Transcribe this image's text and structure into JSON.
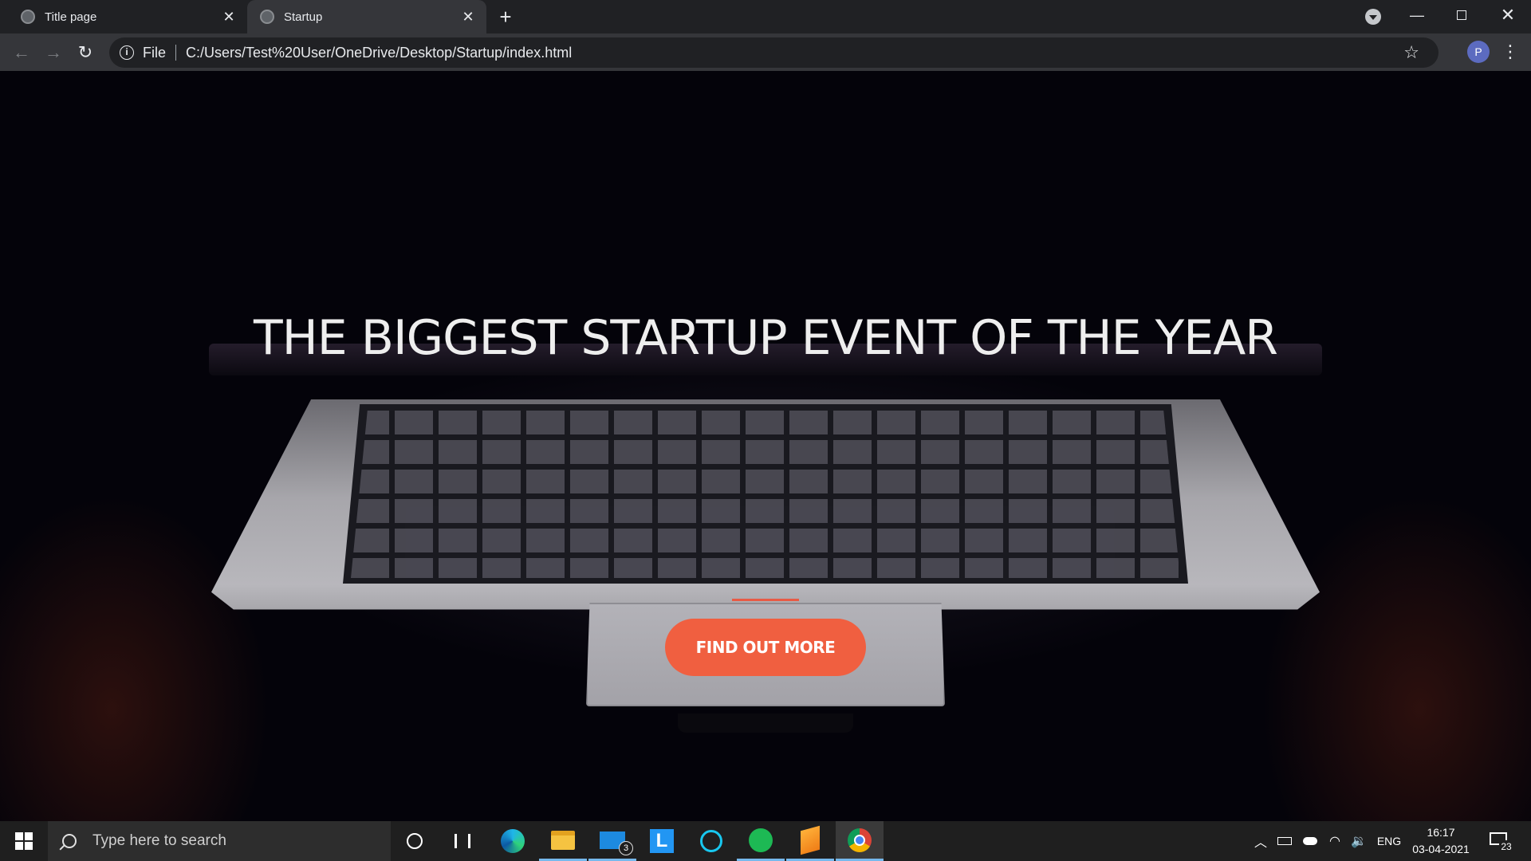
{
  "browser": {
    "tabs": [
      {
        "title": "Title page",
        "active": false
      },
      {
        "title": "Startup",
        "active": true
      }
    ],
    "new_tab_symbol": "+",
    "address_bar": {
      "scheme_label": "File",
      "url": "C:/Users/Test%20User/OneDrive/Desktop/Startup/index.html"
    },
    "profile_initial": "P",
    "icons": {
      "back": "arrow-left-icon",
      "forward": "arrow-right-icon",
      "reload": "reload-icon",
      "info": "info-icon",
      "bookmark": "star-icon",
      "menu": "kebab-menu-icon"
    }
  },
  "page": {
    "hero_title": "THE BIGGEST STARTUP EVENT OF THE YEAR",
    "cta_label": "FIND OUT MORE",
    "colors": {
      "accent": "#f05f40",
      "title": "#eeeeee",
      "background": "#04030a"
    }
  },
  "taskbar": {
    "search_placeholder": "Type here to search",
    "apps": [
      {
        "name": "cortana-icon"
      },
      {
        "name": "task-view-icon"
      },
      {
        "name": "edge-icon"
      },
      {
        "name": "file-explorer-icon"
      },
      {
        "name": "mail-icon",
        "badge": "3"
      },
      {
        "name": "l-app-icon",
        "label": "L"
      },
      {
        "name": "alexa-icon"
      },
      {
        "name": "spotify-icon"
      },
      {
        "name": "sublime-text-icon"
      },
      {
        "name": "chrome-icon"
      }
    ],
    "tray": {
      "language": "ENG",
      "time": "16:17",
      "date": "03-04-2021",
      "notification_count": "23"
    }
  }
}
